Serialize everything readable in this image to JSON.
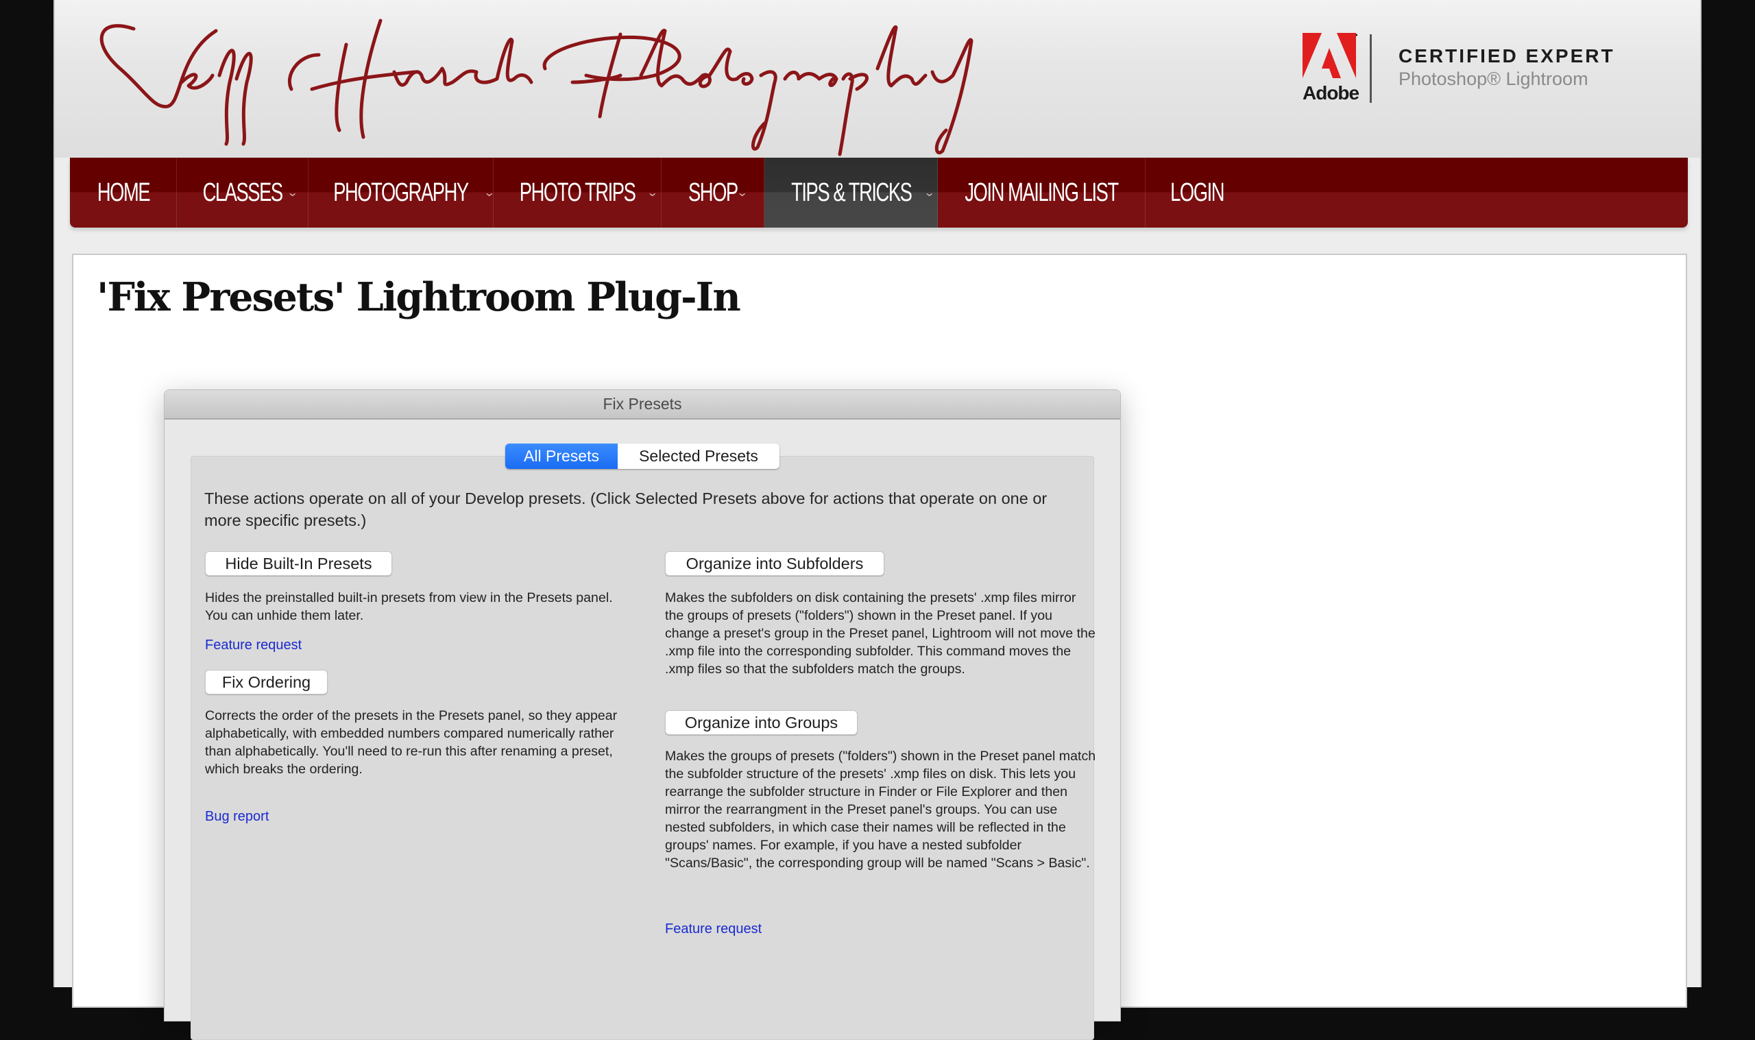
{
  "header": {
    "site_logo_text": "Jeff Hirsch Photography",
    "badge": {
      "brand": "Adobe",
      "line1": "CERTIFIED EXPERT",
      "line2": "Photoshop® Lightroom"
    }
  },
  "nav": {
    "items": [
      {
        "label": "HOME",
        "has_dropdown": false,
        "active": false
      },
      {
        "label": "CLASSES",
        "has_dropdown": true,
        "active": false
      },
      {
        "label": "PHOTOGRAPHY",
        "has_dropdown": true,
        "active": false
      },
      {
        "label": "PHOTO TRIPS",
        "has_dropdown": true,
        "active": false
      },
      {
        "label": "SHOP",
        "has_dropdown": true,
        "active": false
      },
      {
        "label": "TIPS & TRICKS",
        "has_dropdown": true,
        "active": true
      },
      {
        "label": "JOIN MAILING LIST",
        "has_dropdown": false,
        "active": false
      },
      {
        "label": "LOGIN",
        "has_dropdown": false,
        "active": false
      }
    ],
    "dropdown_glyph": "⌄"
  },
  "page": {
    "title": "'Fix Presets' Lightroom Plug-In"
  },
  "dialog": {
    "title": "Fix Presets",
    "tabs": [
      {
        "label": "All Presets",
        "selected": true
      },
      {
        "label": "Selected Presets",
        "selected": false
      }
    ],
    "intro": "These actions operate on all of your Develop presets. (Click Selected Presets above for actions that operate on one or more specific presets.)",
    "left_column": {
      "hide_builtin": {
        "button": "Hide Built-In Presets",
        "description": "Hides the preinstalled built-in presets from view in the Presets panel. You can unhide them later.",
        "link": "Feature request"
      },
      "fix_ordering": {
        "button": "Fix Ordering",
        "description": "Corrects the order of the presets in the Presets panel, so they appear alphabetically, with embedded numbers compared numerically rather than alphabetically. You'll need to re-run this after renaming a preset, which breaks the ordering.",
        "link": "Bug report"
      }
    },
    "right_column": {
      "organize_subfolders": {
        "button": "Organize into Subfolders",
        "description": "Makes the subfolders on disk containing the presets' .xmp files mirror the groups of presets (\"folders\") shown in the Preset panel. If you change a preset's group in the Preset panel, Lightroom will not move the .xmp file into the corresponding subfolder. This command moves the .xmp files so that the subfolders match the groups."
      },
      "organize_groups": {
        "button": "Organize into Groups",
        "description": "Makes the groups of presets (\"folders\") shown in the Preset panel match the subfolder structure of the presets' .xmp files on disk. This lets you rearrange the subfolder structure in Finder or File Explorer and then mirror the rearrangment in the Preset panel's groups.  You can use nested subfolders, in which case their names will be reflected in the groups' names. For example, if you have a nested subfolder \"Scans/Basic\", the corresponding group will be named \"Scans > Basic\".",
        "link": "Feature request"
      }
    }
  },
  "colors": {
    "nav_dark_red": "#650000",
    "nav_red": "#7a1012",
    "nav_active": "#3a3a3a",
    "logo_script": "#8b1518",
    "adobe_red": "#e01e1e",
    "tab_selected_blue": "#1a6cf3",
    "link_blue": "#1a2ad0"
  }
}
